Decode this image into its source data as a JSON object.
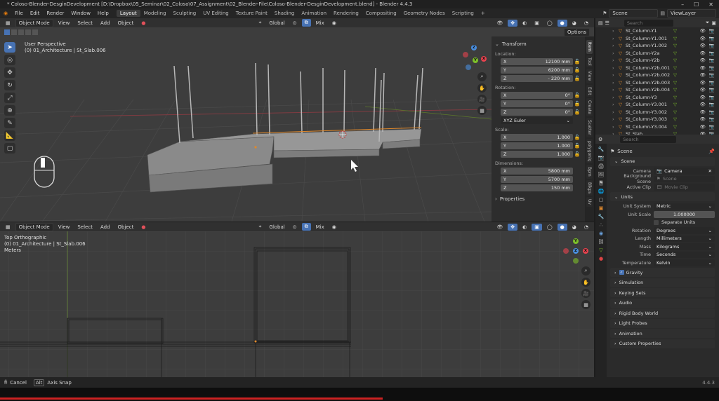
{
  "window": {
    "title": "* Coloso-Blender-DesginDevelopment [D:\\Dropbox\\05_Seminar\\02_Coloso\\07_Assignment\\02_Blender-File\\Coloso-Blender-DesginDevelopment.blend] - Blender 4.4.3"
  },
  "menu": [
    "File",
    "Edit",
    "Render",
    "Window",
    "Help"
  ],
  "workspaces": [
    "Layout",
    "Modeling",
    "Sculpting",
    "UV Editing",
    "Texture Paint",
    "Shading",
    "Animation",
    "Rendering",
    "Compositing",
    "Geometry Nodes",
    "Scripting"
  ],
  "topbar_right": {
    "scene": "Scene",
    "view_layer": "ViewLayer"
  },
  "viewport_top": {
    "mode": "Object Mode",
    "menus": [
      "View",
      "Select",
      "Add",
      "Object"
    ],
    "orientation": "Global",
    "shading_mix": "Mix",
    "view_name": "User Perspective",
    "collection_info": "(0) 01_Architecture | St_Slab.006",
    "options_label": "Options"
  },
  "npanel": {
    "title": "Transform",
    "location_label": "Location:",
    "location": [
      {
        "axis": "X",
        "value": "12100 mm"
      },
      {
        "axis": "Y",
        "value": "6200 mm"
      },
      {
        "axis": "Z",
        "value": "- 220 mm"
      }
    ],
    "rotation_label": "Rotation:",
    "rotation": [
      {
        "axis": "X",
        "value": "0°"
      },
      {
        "axis": "Y",
        "value": "0°"
      },
      {
        "axis": "Z",
        "value": "0°"
      }
    ],
    "rotation_mode": "XYZ Euler",
    "scale_label": "Scale:",
    "scale": [
      {
        "axis": "X",
        "value": "1.000"
      },
      {
        "axis": "Y",
        "value": "1.000"
      },
      {
        "axis": "Z",
        "value": "1.000"
      }
    ],
    "dimensions_label": "Dimensions:",
    "dimensions": [
      {
        "axis": "X",
        "value": "5800 mm"
      },
      {
        "axis": "Y",
        "value": "5700 mm"
      },
      {
        "axis": "Z",
        "value": "150 mm"
      }
    ],
    "properties_label": "Properties",
    "tabs": [
      "Item",
      "Tool",
      "View",
      "Edit",
      "Create",
      "Scatter",
      "polygoniq",
      "Bpm",
      "Blkps",
      "Uv"
    ]
  },
  "viewport_bottom": {
    "mode": "Object Mode",
    "menus": [
      "View",
      "Select",
      "Add",
      "Object"
    ],
    "orientation": "Global",
    "shading_mix": "Mix",
    "view_name": "Top Orthographic",
    "collection_info": "(0) 01_Architecture | St_Slab.006",
    "units": "Meters"
  },
  "gizmo": {
    "x": "X",
    "y": "Y",
    "z": "Z"
  },
  "outliner": {
    "search_placeholder": "Search",
    "items": [
      "St_Column-Y1",
      "St_Column-Y1.001",
      "St_Column-Y1.002",
      "St_Column-Y2a",
      "St_Column-Y2b",
      "St_Column-Y2b.001",
      "St_Column-Y2b.002",
      "St_Column-Y2b.003",
      "St_Column-Y2b.004",
      "St_Column-Y3",
      "St_Column-Y3.001",
      "St_Column-Y3.002",
      "St_Column-Y3.003",
      "St_Column-Y3.004",
      "St_Slab"
    ]
  },
  "properties": {
    "search_placeholder": "Search",
    "breadcrumb": "Scene",
    "scene_section": "Scene",
    "camera_label": "Camera",
    "camera_value": "Camera",
    "bg_scene_label": "Background Scene",
    "bg_scene_value": "Scene",
    "active_clip_label": "Active Clip",
    "active_clip_value": "Movie Clip",
    "units_section": "Units",
    "unit_system_label": "Unit System",
    "unit_system_value": "Metric",
    "unit_scale_label": "Unit Scale",
    "unit_scale_value": "1.000000",
    "separate_units": "Separate Units",
    "rotation_label": "Rotation",
    "rotation_value": "Degrees",
    "length_label": "Length",
    "length_value": "Millimeters",
    "mass_label": "Mass",
    "mass_value": "Kilograms",
    "time_label": "Time",
    "time_value": "Seconds",
    "temperature_label": "Temperature",
    "temperature_value": "Kelvin",
    "gravity": "Gravity",
    "sections": [
      "Simulation",
      "Keying Sets",
      "Audio",
      "Rigid Body World",
      "Light Probes",
      "Animation",
      "Custom Properties"
    ]
  },
  "statusbar": {
    "cancel": "Cancel",
    "alt_key": "Alt",
    "axis_snap": "Axis Snap",
    "version": "4.4.3"
  },
  "colors": {
    "accent": "#4772b3",
    "x_axis": "#e6424e",
    "y_axis": "#7dbf2a",
    "z_axis": "#4a8fe0",
    "object_orange": "#e0892c"
  }
}
